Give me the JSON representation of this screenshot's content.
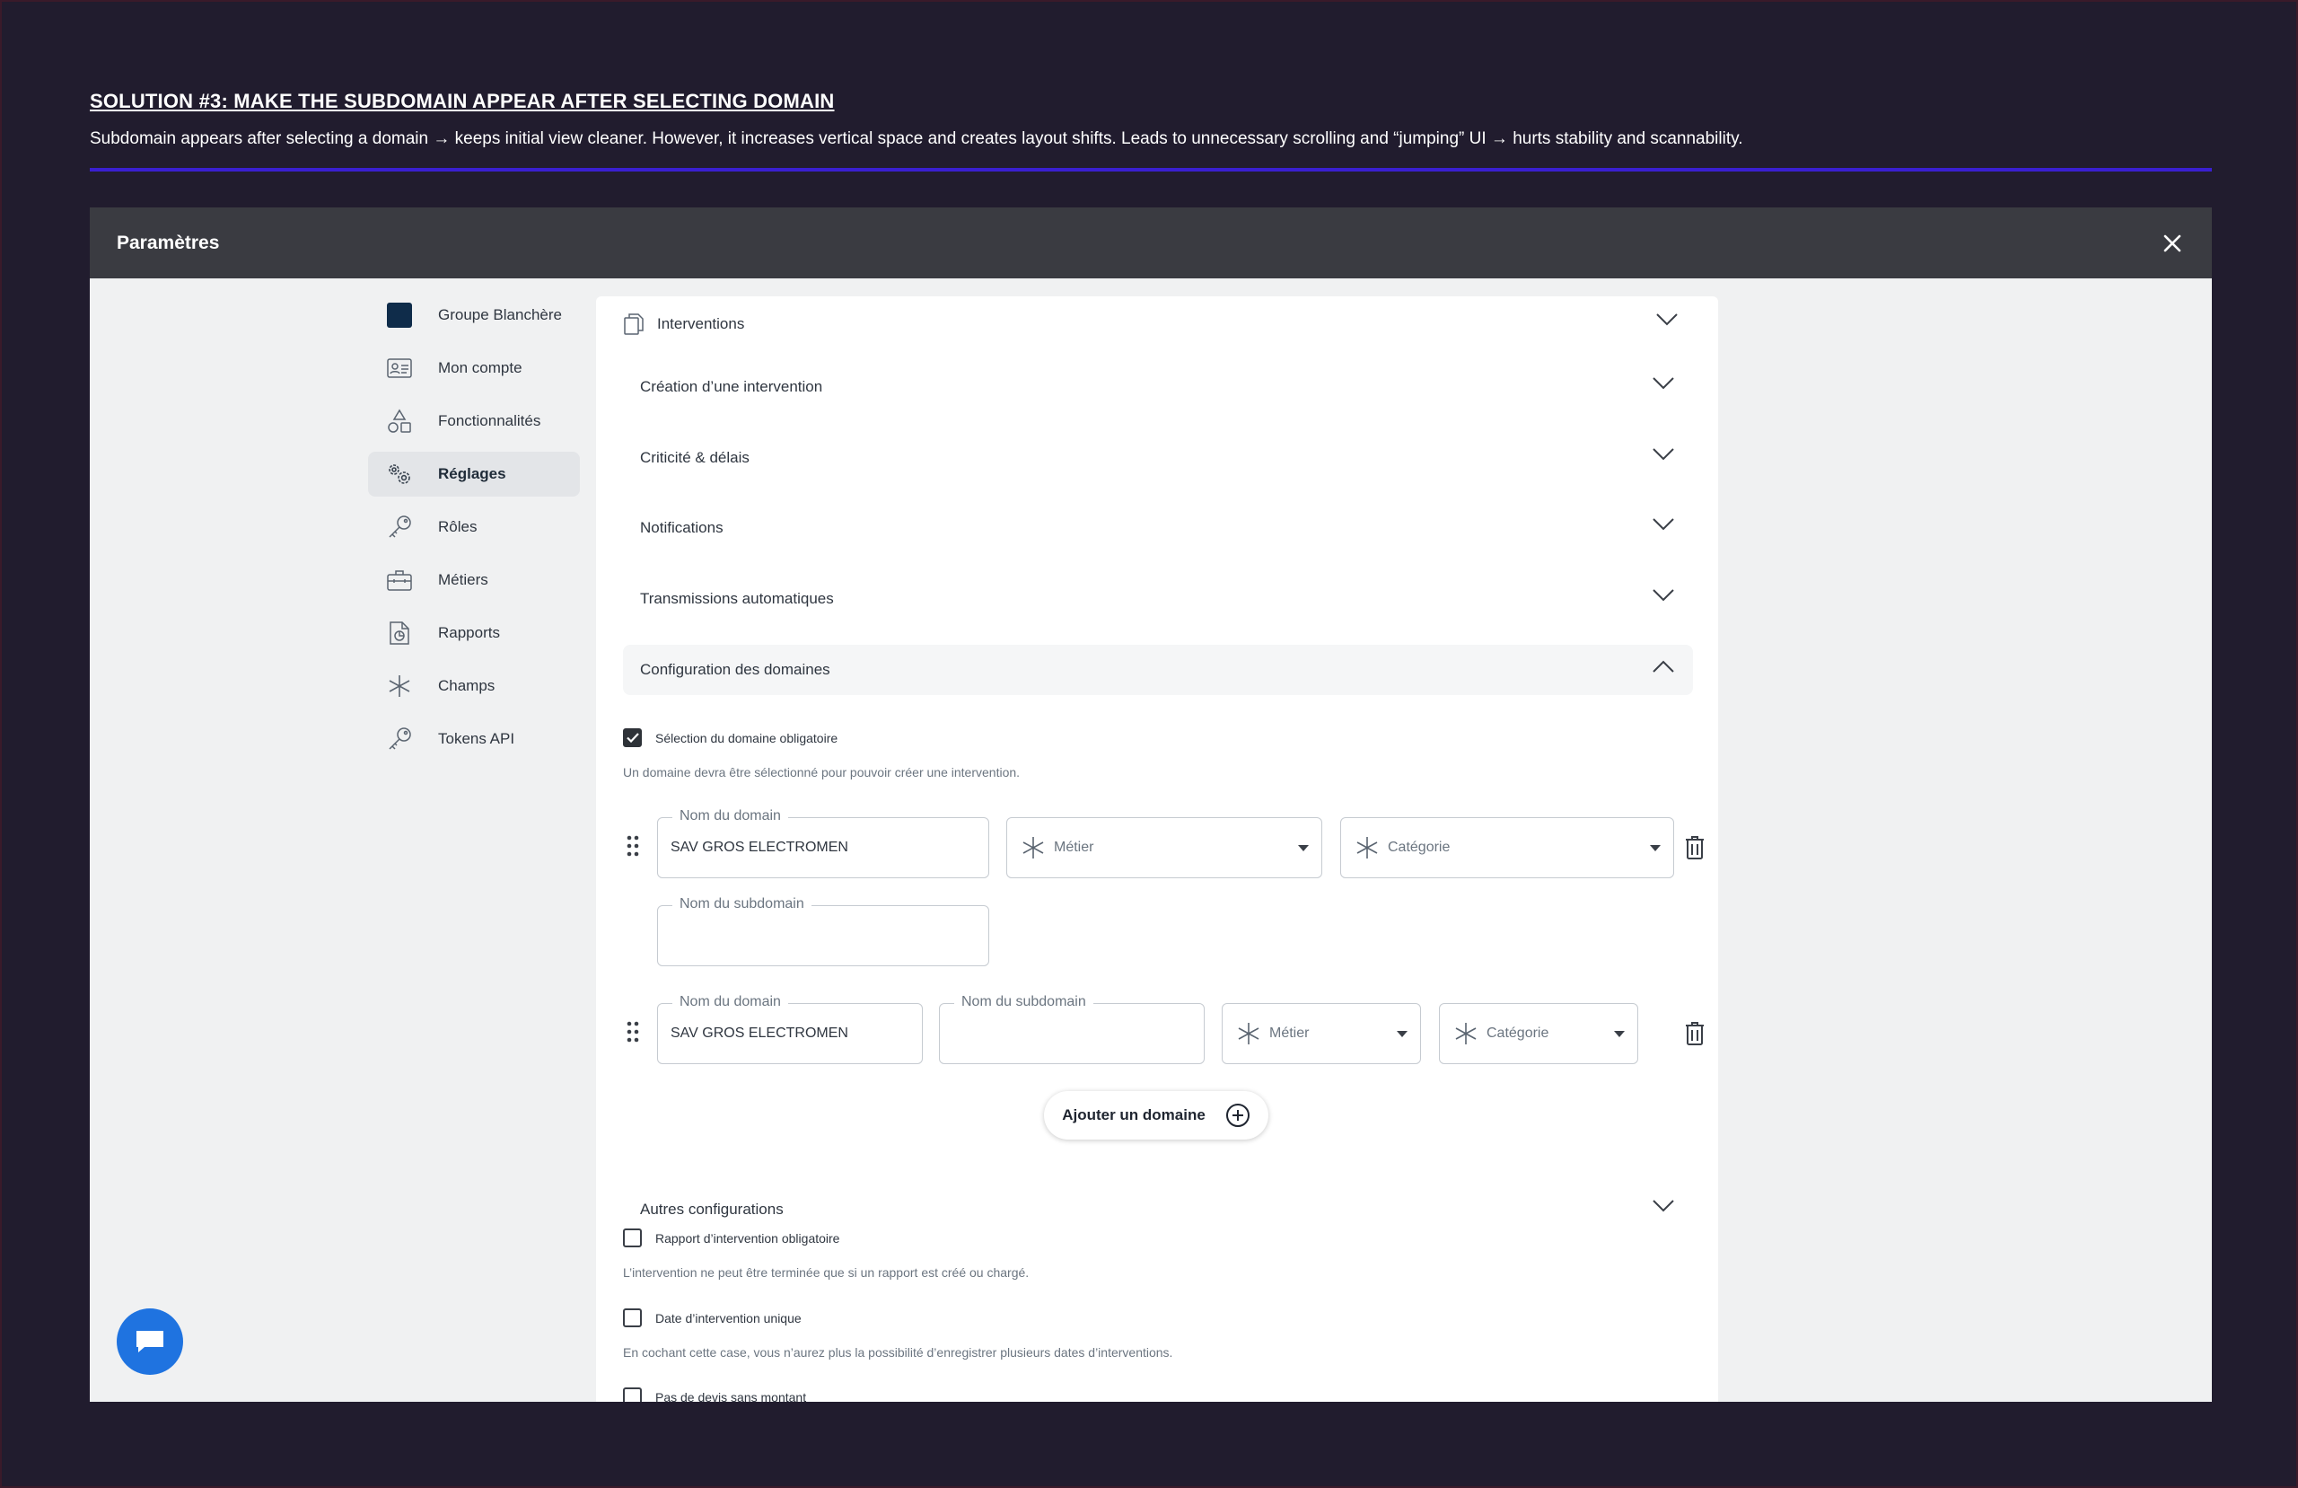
{
  "doc": {
    "title": "SOLUTION #3: MAKE THE SUBDOMAIN APPEAR AFTER SELECTING DOMAIN",
    "description": "Subdomain appears after selecting a domain → keeps initial view cleaner. However, it increases vertical space and creates layout shifts. Leads to unnecessary scrolling and “jumping” UI → hurts stability and scannability."
  },
  "modal": {
    "title": "Paramètres"
  },
  "sidebar": {
    "items": [
      {
        "label": "Groupe Blanchère",
        "icon": "org-square-icon"
      },
      {
        "label": "Mon compte",
        "icon": "id-card-icon"
      },
      {
        "label": "Fonctionnalités",
        "icon": "shapes-icon"
      },
      {
        "label": "Réglages",
        "icon": "gears-icon",
        "active": true
      },
      {
        "label": "Rôles",
        "icon": "key-icon"
      },
      {
        "label": "Métiers",
        "icon": "toolbox-icon"
      },
      {
        "label": "Rapports",
        "icon": "report-file-icon"
      },
      {
        "label": "Champs",
        "icon": "asterisk-icon"
      },
      {
        "label": "Tokens API",
        "icon": "key-icon"
      }
    ]
  },
  "panel": {
    "title": "Interventions",
    "sections": [
      "Création d’une intervention",
      "Criticité & délais",
      "Notifications",
      "Transmissions automatiques",
      "Configuration des domaines"
    ],
    "domain_config": {
      "required_label": "Sélection du domaine obligatoire",
      "required_help": "Un domaine devra être sélectionné pour pouvoir créer une intervention.",
      "domain_label": "Nom du domain",
      "subdomain_label": "Nom du subdomain",
      "metier_placeholder": "Métier",
      "categorie_placeholder": "Catégorie",
      "rows": [
        {
          "domain": "SAV GROS ELECTROMEN",
          "subdomain": ""
        },
        {
          "domain": "SAV GROS ELECTROMEN",
          "subdomain": ""
        }
      ],
      "add_label": "Ajouter un domaine"
    },
    "other": {
      "title": "Autres configurations",
      "options": [
        {
          "label": "Rapport d’intervention obligatoire",
          "help": "L’intervention ne peut être terminée que si un rapport est créé ou chargé.",
          "checked": false
        },
        {
          "label": "Date d’intervention unique",
          "help": "En cochant cette case, vous n’aurez plus la possibilité d’enregistrer plusieurs dates d’interventions.",
          "checked": false
        },
        {
          "label": "Pas de devis sans montant",
          "checked": false
        }
      ]
    }
  },
  "colors": {
    "background": "#211c2e",
    "accent_rule": "#3a1fd0",
    "modal_header": "#3a3b41",
    "chat_fab": "#1f73e0"
  }
}
